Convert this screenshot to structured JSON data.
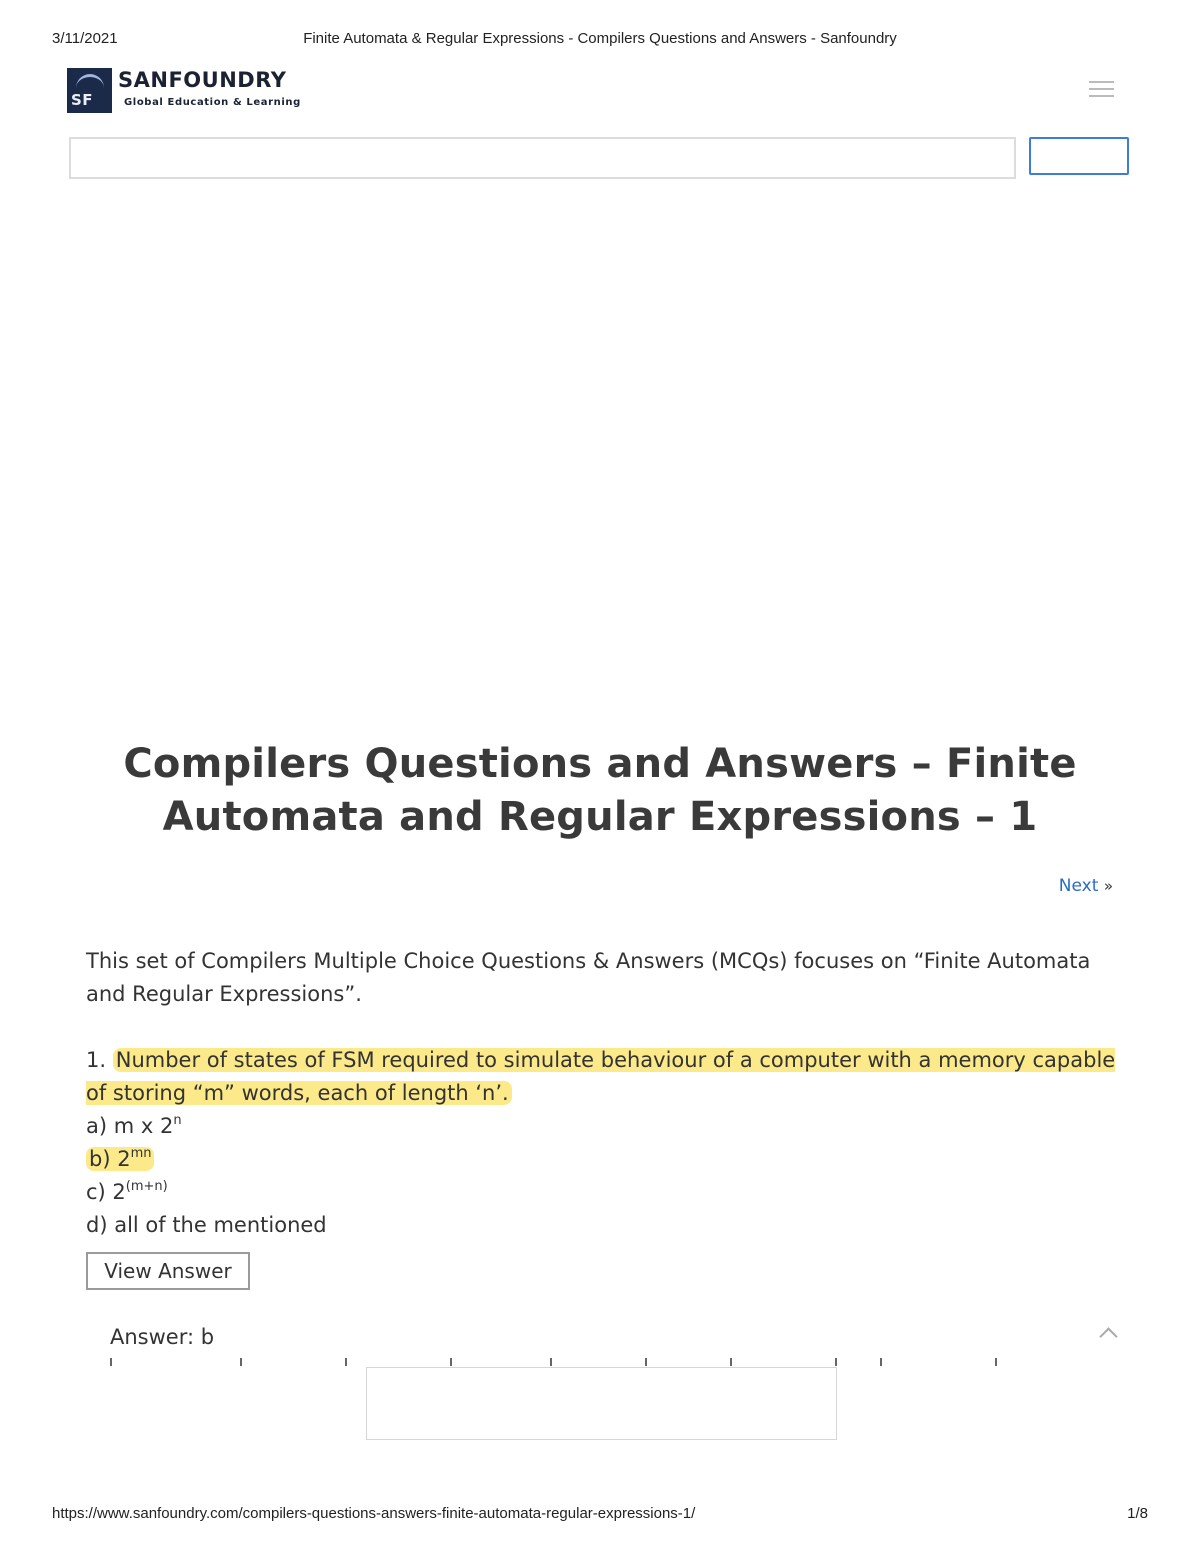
{
  "print_header": {
    "date": "3/11/2021",
    "title": "Finite Automata & Regular Expressions - Compilers Questions and Answers - Sanfoundry"
  },
  "print_footer": {
    "url": "https://www.sanfoundry.com/compilers-questions-answers-finite-automata-regular-expressions-1/",
    "page": "1/8"
  },
  "site": {
    "logo_mark_text": "SF",
    "name": "SANFOUNDRY",
    "tagline": "Global Education & Learning",
    "menu_icon": "hamburger-menu-icon"
  },
  "search": {
    "placeholder": "",
    "button_label": ""
  },
  "article": {
    "title": "Compilers Questions and Answers – Finite Automata and Regular Expressions – 1",
    "next_label": "Next",
    "next_arrow": "»",
    "intro": "This set of Compilers Multiple Choice Questions & Answers (MCQs) focuses on “Finite Automata and Regular Expressions”.",
    "question": {
      "number": "1.",
      "text": "Number of states of FSM required to simulate behaviour of a computer with a memory capable of storing “m” words, each of length ‘n’.",
      "options": [
        {
          "prefix": "a) m x 2",
          "sup": "n"
        },
        {
          "prefix": "b) 2",
          "sup": "mn"
        },
        {
          "prefix": "c) 2",
          "sup": "(m+n)"
        },
        {
          "prefix": "d) all of the mentioned",
          "sup": ""
        }
      ]
    },
    "view_answer_label": "View Answer",
    "answer_text": "Answer: b"
  },
  "colors": {
    "highlight": "#fbe98a",
    "link": "#2a6cc4",
    "search_button_border": "#3b7dd8"
  }
}
